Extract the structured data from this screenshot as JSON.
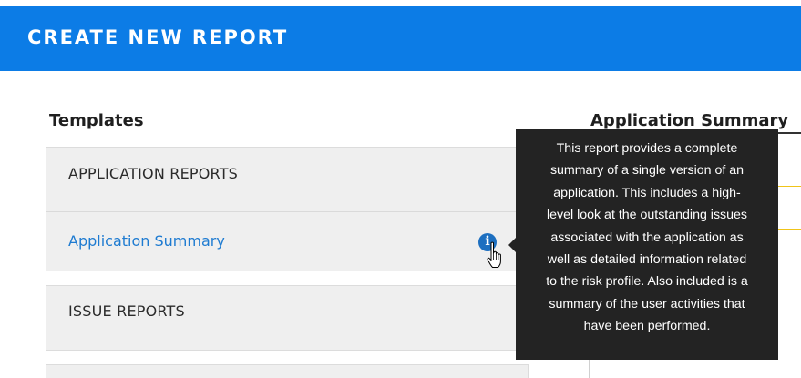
{
  "header": {
    "title": "CREATE NEW REPORT"
  },
  "templates": {
    "heading": "Templates",
    "groups": [
      {
        "label": "APPLICATION REPORTS",
        "items": [
          {
            "label": "Application Summary"
          }
        ]
      },
      {
        "label": "ISSUE REPORTS"
      }
    ]
  },
  "detail": {
    "heading": "Application Summary"
  },
  "tooltip": {
    "lines": [
      "This report provides a complete",
      "summary of a single version of an",
      "application.  This includes a high-",
      "level look at the outstanding issues",
      "associated with the application as",
      "well as detailed information related",
      "to the risk profile.  Also included is a",
      "summary of the user activities that",
      "have been performed."
    ]
  },
  "icons": {
    "info": "info-icon",
    "cursor": "hand-pointer-icon"
  },
  "colors": {
    "header": "#0c7ce6",
    "link": "#1e7bd1",
    "tooltip_bg": "#232323",
    "accent": "#f0c419"
  }
}
